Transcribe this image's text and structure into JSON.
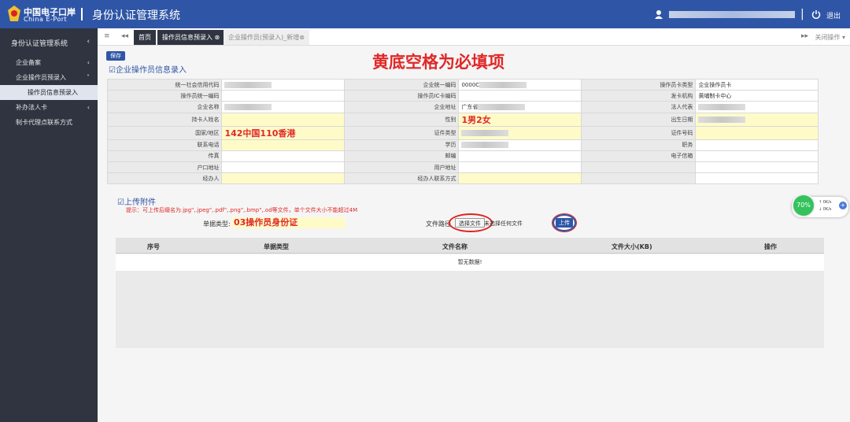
{
  "header": {
    "brand_cn": "中国电子口岸",
    "brand_en": "China E-Port",
    "system_title": "身份认证管理系统",
    "separator": "|",
    "logout": "退出"
  },
  "sidebar": {
    "title": "身份认证管理系统",
    "items": [
      {
        "label": "企业备案",
        "chev": "‹"
      },
      {
        "label": "企业操作员预录入",
        "chev": "˅"
      },
      {
        "label": "操作员信息预录入",
        "chev": ""
      },
      {
        "label": "补办法人卡",
        "chev": "‹"
      },
      {
        "label": "制卡代理点联系方式",
        "chev": ""
      }
    ]
  },
  "tabs": {
    "menu_icon": "≡",
    "back_icon": "◂◂",
    "home": "首页",
    "tab1": "操作员信息预录入 ⊗",
    "tab2": "企业操作员(预录入)_新增⊗",
    "forward_icon": "▸▸",
    "close_ops": "关闭操作 ▾"
  },
  "toolbar": {
    "save": "保存"
  },
  "section1": {
    "title": "企业操作员信息录入"
  },
  "annotation_top": "黄底空格为必填项",
  "form_rows": [
    [
      {
        "l": "统一社会信用代码",
        "v": "",
        "req": false,
        "blur": true
      },
      {
        "l": "企业统一编码",
        "v": "0000C",
        "req": false,
        "blur": true
      },
      {
        "l": "操作员卡类型",
        "v": "企业操作员卡",
        "req": false,
        "blur": false
      }
    ],
    [
      {
        "l": "操作员统一编码",
        "v": "",
        "req": false,
        "blur": false
      },
      {
        "l": "操作员IC卡编码",
        "v": "",
        "req": false,
        "blur": false
      },
      {
        "l": "发卡机构",
        "v": "黄埔制卡中心",
        "req": false,
        "blur": false
      }
    ],
    [
      {
        "l": "企业名称",
        "v": "",
        "req": false,
        "blur": true
      },
      {
        "l": "企业地址",
        "v": "广东省",
        "req": false,
        "blur": true
      },
      {
        "l": "法人代表",
        "v": "",
        "req": false,
        "blur": true
      }
    ],
    [
      {
        "l": "持卡人姓名",
        "v": "",
        "req": true,
        "blur": false
      },
      {
        "l": "性别",
        "v": "1男2女",
        "req": true,
        "blur": false,
        "annot": true
      },
      {
        "l": "出生日期",
        "v": "",
        "req": true,
        "blur": true
      }
    ],
    [
      {
        "l": "国家/地区",
        "v": "142中国110香港",
        "req": true,
        "blur": false,
        "annot": true
      },
      {
        "l": "证件类型",
        "v": "",
        "req": true,
        "blur": true
      },
      {
        "l": "证件号码",
        "v": "",
        "req": true,
        "blur": false
      }
    ],
    [
      {
        "l": "联系电话",
        "v": "",
        "req": true,
        "blur": false
      },
      {
        "l": "学历",
        "v": "",
        "req": false,
        "blur": true
      },
      {
        "l": "职务",
        "v": "",
        "req": false,
        "blur": false
      }
    ],
    [
      {
        "l": "传真",
        "v": "",
        "req": false,
        "blur": false
      },
      {
        "l": "邮编",
        "v": "",
        "req": false,
        "blur": false
      },
      {
        "l": "电子信箱",
        "v": "",
        "req": false,
        "blur": false
      }
    ],
    [
      {
        "l": "户口地址",
        "v": "",
        "req": false,
        "blur": false
      },
      {
        "l": "用户地址",
        "v": "",
        "req": false,
        "blur": false
      },
      {
        "l": "",
        "v": "",
        "req": false,
        "blur": false
      }
    ],
    [
      {
        "l": "经办人",
        "v": "",
        "req": true,
        "blur": false
      },
      {
        "l": "经办人联系方式",
        "v": "",
        "req": true,
        "blur": false
      },
      {
        "l": "",
        "v": "",
        "req": false,
        "blur": false
      }
    ]
  ],
  "section2": {
    "title": "上传附件"
  },
  "upload": {
    "hint": "提示：可上传后缀名为.jpg\",.jpeg\",.pdf\",.png\",.bmp\",.od等文件，单个文件大小不能超过4M",
    "doctype_label": "单据类型:",
    "doctype_value": "03操作员身份证",
    "filepath_label": "文件路径",
    "choose_button": "选择文件",
    "no_file": "未选择任何文件",
    "upload_button": "上传"
  },
  "grid": {
    "columns": [
      "序号",
      "单据类型",
      "文件名称",
      "文件大小(KB)",
      "操作"
    ],
    "empty": "暂无数据!"
  },
  "widget": {
    "percent": "70%",
    "up": "0K/s",
    "down": "0K/s",
    "plus": "+"
  }
}
